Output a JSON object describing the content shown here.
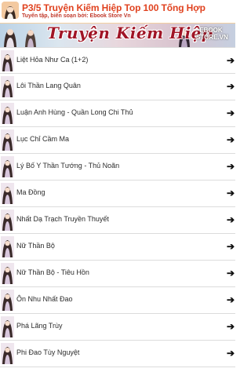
{
  "header": {
    "title": "P3/5 Truyện Kiếm Hiệp Top 100 Tống Hợp",
    "subtitle": "Tuyển tập, biên soạn bởi: Ebook Store Vn",
    "app_icon": "girl-portrait-icon"
  },
  "banner": {
    "title": "Truyện Kiếm Hiệp",
    "brand": "EBOOK STORE.VN"
  },
  "list": {
    "arrow_icon": "right-arrow-icon",
    "thumbnail_icon": "girl-portrait-thumbnail",
    "items": [
      {
        "label": "Liệt Hỏa Như Ca (1+2)"
      },
      {
        "label": "Lôi Thần Lang Quân"
      },
      {
        "label": "Luận Anh Hùng - Quần Long Chi Thủ"
      },
      {
        "label": "Lục Chỉ Cầm Ma"
      },
      {
        "label": "Lý Bố Y Thần Tướng - Thủ Noãn"
      },
      {
        "label": "Ma Đồng"
      },
      {
        "label": "Nhất Dạ Trạch Truyền Thuyết"
      },
      {
        "label": "Nữ Thần Bộ"
      },
      {
        "label": "Nữ Thần Bộ - Tiêu Hồn"
      },
      {
        "label": "Ôn Nhu Nhất Đao"
      },
      {
        "label": "Phá Lãng Trùy"
      },
      {
        "label": "Phi Đao Tùy Nguyệt"
      }
    ]
  },
  "colors": {
    "title": "#e0421f",
    "banner_title": "#a01526",
    "divider": "#dcdcdc"
  }
}
